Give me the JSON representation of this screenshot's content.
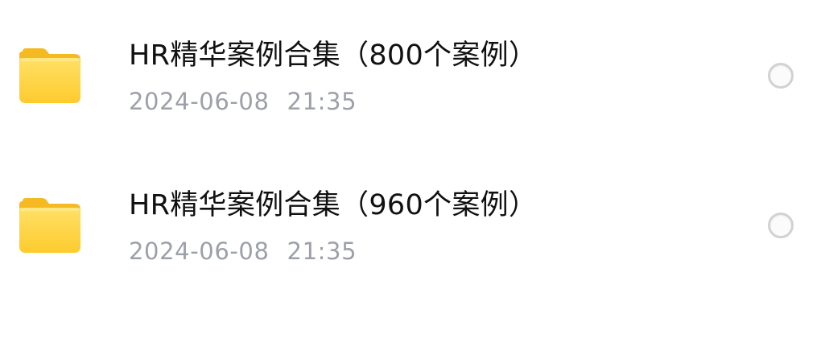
{
  "files": [
    {
      "name": "HR精华案例合集（800个案例）",
      "date": "2024-06-08",
      "time": "21:35",
      "icon": "folder-icon",
      "selected": false
    },
    {
      "name": "HR精华案例合集（960个案例）",
      "date": "2024-06-08",
      "time": "21:35",
      "icon": "folder-icon",
      "selected": false
    }
  ],
  "colors": {
    "folder_body": "#FDD33A",
    "folder_tab": "#F5B922",
    "name_text": "#111111",
    "date_text": "#9CA0A8",
    "radio_border": "#D2D2D2"
  }
}
